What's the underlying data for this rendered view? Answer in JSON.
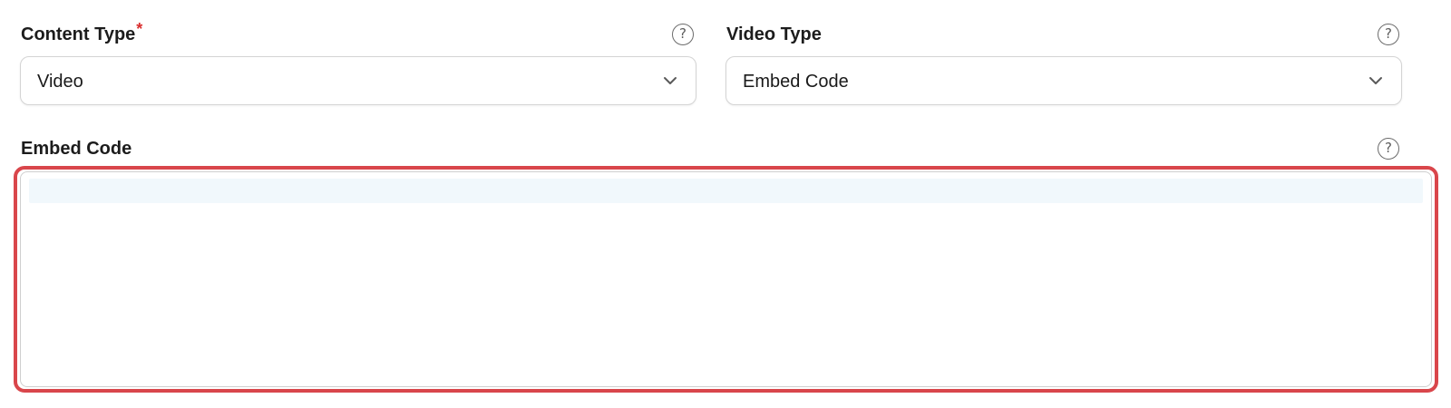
{
  "content_type": {
    "label": "Content Type",
    "required_mark": "*",
    "value": "Video",
    "help_icon": "question-circle-icon"
  },
  "video_type": {
    "label": "Video Type",
    "value": "Embed Code",
    "help_icon": "question-circle-icon"
  },
  "embed_code": {
    "label": "Embed Code",
    "value": "",
    "help_icon": "question-circle-icon"
  },
  "colors": {
    "required": "#d92d2d",
    "highlight_outline": "#d9464b",
    "active_line": "#f1f8fc"
  }
}
